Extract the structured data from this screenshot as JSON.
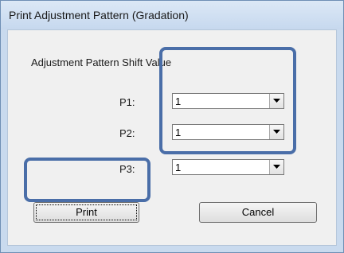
{
  "window": {
    "title": "Print Adjustment Pattern (Gradation)"
  },
  "section": {
    "label": "Adjustment Pattern Shift Value"
  },
  "rows": [
    {
      "label": "P1:",
      "value": "1"
    },
    {
      "label": "P2:",
      "value": "1"
    },
    {
      "label": "P3:",
      "value": "1"
    }
  ],
  "buttons": {
    "print": "Print",
    "cancel": "Cancel"
  },
  "colors": {
    "highlight": "#4a6ea8",
    "titlebar": "#c9daee"
  },
  "icons": {
    "dropdown": "chevron-down-icon"
  }
}
